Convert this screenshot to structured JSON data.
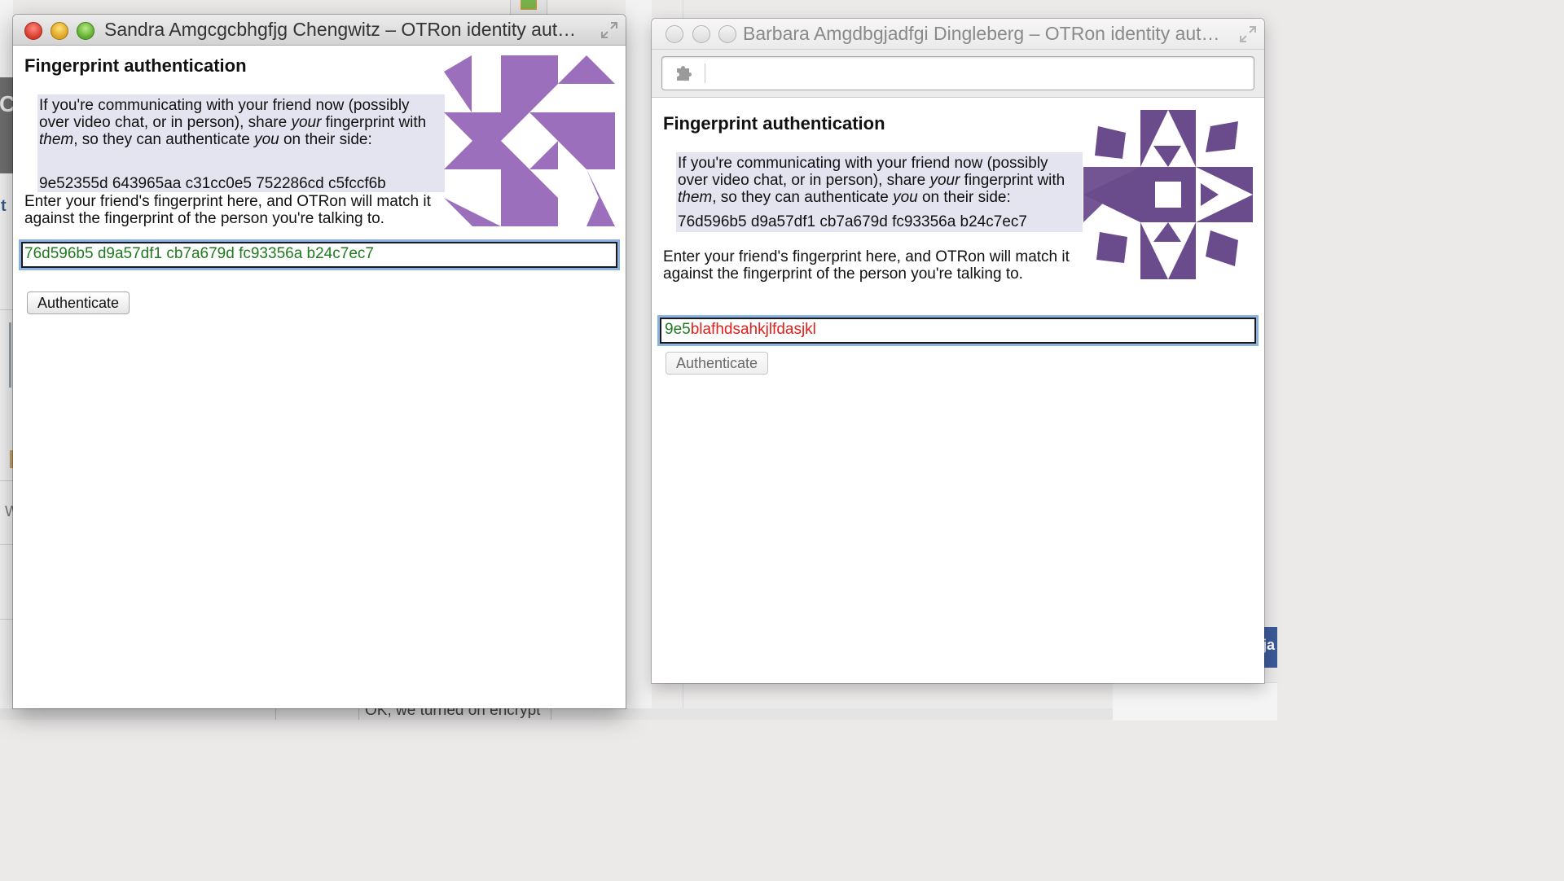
{
  "background": {
    "bottom_snippet": "OK, we turned on encrypt",
    "right_tab_text": "ja"
  },
  "windows": [
    {
      "title": "Sandra Amgcgcbhgfjg Chengwitz – OTRon identity aut…",
      "heading": "Fingerprint authentication",
      "info_part1": "If you're communicating with your friend now (possibly over video chat, or in person), share ",
      "info_em1": "your",
      "info_part2": " fingerprint with ",
      "info_em2": "them",
      "info_part3": ", so they can authenticate ",
      "info_em3": "you",
      "info_part4": " on their side:",
      "my_fingerprint": "9e52355d 643965aa c31cc0e5 752286cd c5fccf6b",
      "enter_text": "Enter your friend's fingerprint here, and OTRon will match it against the fingerprint of the person you're talking to.",
      "input_value": "76d596b5 d9a57df1 cb7a679d fc93356a b24c7ec7",
      "button_label": "Authenticate",
      "identicon_color": "#9b6fbb",
      "state": "active"
    },
    {
      "title": "Barbara Amgdbgjadfgi Dingleberg – OTRon identity aut…",
      "heading": "Fingerprint authentication",
      "info_part1": "If you're communicating with your friend now (possibly over video chat, or in person), share ",
      "info_em1": "your",
      "info_part2": " fingerprint with ",
      "info_em2": "them",
      "info_part3": ", so they can authenticate ",
      "info_em3": "you",
      "info_part4": " on their side:",
      "my_fingerprint": "76d596b5 d9a57df1 cb7a679d fc93356a b24c7ec7",
      "enter_text": "Enter your friend's fingerprint here, and OTRon will match it against the fingerprint of the person you're talking to.",
      "input_matching": "9e5",
      "input_mismatch": "blafhdsahkjlfdasjkl",
      "button_label": "Authenticate",
      "identicon_color": "#6a4c8c",
      "state": "inactive"
    }
  ],
  "colors": {
    "match_text": "#1f7a1f",
    "mismatch_text": "#e0201b",
    "focus_ring": "#8ab3e3",
    "info_background": "#e4e4f0"
  },
  "icons": [
    "puzzle-icon",
    "fullscreen-icon"
  ]
}
